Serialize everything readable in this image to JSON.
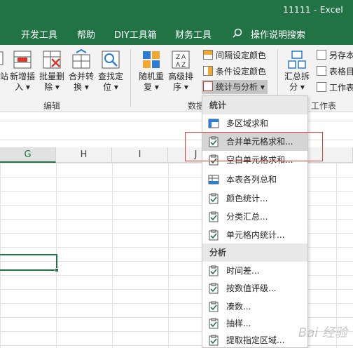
{
  "window": {
    "title": "11111  -  Excel"
  },
  "tabs": [
    {
      "label": "开发工具"
    },
    {
      "label": "帮助"
    },
    {
      "label": "DIY工具箱"
    },
    {
      "label": "财务工具"
    },
    {
      "label": "操作说明搜索"
    }
  ],
  "ribbon": {
    "buttons": [
      {
        "label1": "站",
        "label2": ""
      },
      {
        "label1": "新增插",
        "label2": "入 ▾"
      },
      {
        "label1": "批量删",
        "label2": "除 ▾"
      },
      {
        "label1": "合并转",
        "label2": "换 ▾"
      },
      {
        "label1": "查找定",
        "label2": "位 ▾"
      },
      {
        "label1": "随机重",
        "label2": "复 ▾"
      },
      {
        "label1": "高级排",
        "label2": "序 ▾"
      },
      {
        "label1": "汇总拆",
        "label2": "分 ▾"
      }
    ],
    "small_buttons": [
      {
        "label": "间隔设定颜色"
      },
      {
        "label": "条件设定颜色"
      },
      {
        "label": "统计与分析 ▾"
      },
      {
        "label": "另存本"
      },
      {
        "label": "表格目"
      },
      {
        "label": "工作表"
      }
    ],
    "groups": [
      {
        "label": "编辑"
      },
      {
        "label": "数据"
      },
      {
        "label": "工作表"
      }
    ]
  },
  "columns": [
    "G",
    "H",
    "I",
    "J"
  ],
  "menu": {
    "section_stats": "统计",
    "section_analysis": "分析",
    "stats_items": [
      {
        "label": "多区域求和"
      },
      {
        "label": "合并单元格求和..."
      },
      {
        "label": "空白单元格求和..."
      },
      {
        "label": "本表各列总和"
      },
      {
        "label": "颜色统计..."
      },
      {
        "label": "分类汇总..."
      },
      {
        "label": "单元格内统计..."
      }
    ],
    "analysis_items": [
      {
        "label": "时间差..."
      },
      {
        "label": "按数值评级..."
      },
      {
        "label": "凑数..."
      },
      {
        "label": "抽样..."
      },
      {
        "label": "提取指定区域..."
      }
    ]
  },
  "watermark": "Bai 经验"
}
